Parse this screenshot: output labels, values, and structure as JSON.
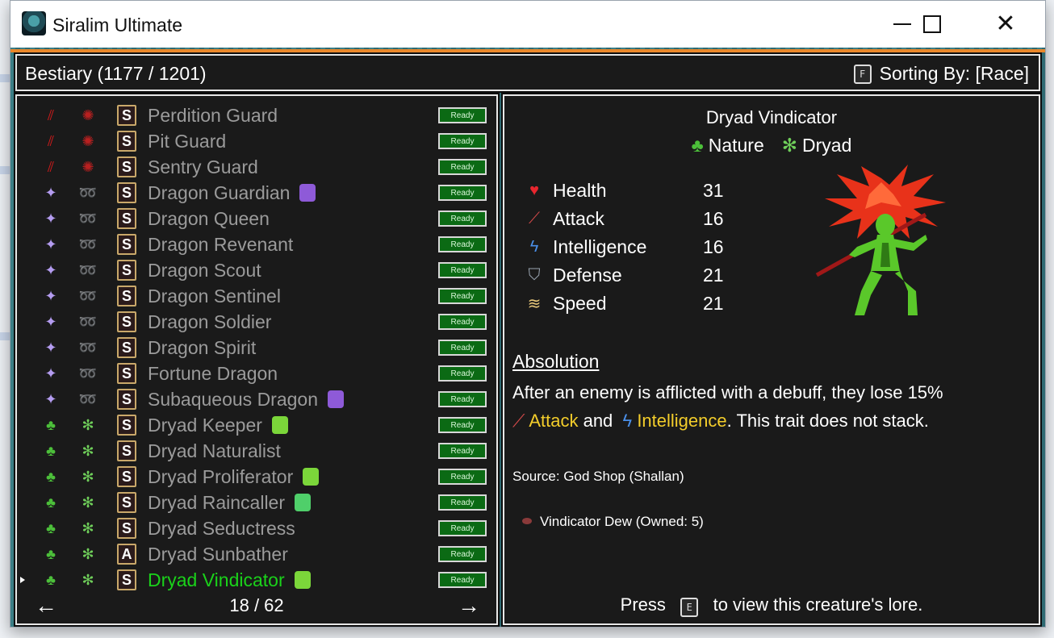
{
  "window": {
    "title": "Siralim Ultimate"
  },
  "header": {
    "bestiary": "Bestiary (1177 / 1201)",
    "sort_key": "F",
    "sorting": "Sorting By: [Race]"
  },
  "list": {
    "rows": [
      {
        "name": "Perdition Guard",
        "class_icon": "claw-icon",
        "race_icon": "demon-icon",
        "rank": "S",
        "status": "Ready"
      },
      {
        "name": "Pit Guard",
        "class_icon": "claw-icon",
        "race_icon": "demon-icon",
        "rank": "S",
        "status": "Ready"
      },
      {
        "name": "Sentry Guard",
        "class_icon": "claw-icon",
        "race_icon": "demon-icon",
        "rank": "S",
        "status": "Ready"
      },
      {
        "name": "Dragon Guardian",
        "class_icon": "sparkle-icon",
        "race_icon": "dragon-icon",
        "rank": "S",
        "status": "Ready",
        "badge": "purple-gem-icon"
      },
      {
        "name": "Dragon Queen",
        "class_icon": "sparkle-icon",
        "race_icon": "dragon-icon",
        "rank": "S",
        "status": "Ready"
      },
      {
        "name": "Dragon Revenant",
        "class_icon": "sparkle-icon",
        "race_icon": "dragon-icon",
        "rank": "S",
        "status": "Ready"
      },
      {
        "name": "Dragon Scout",
        "class_icon": "sparkle-icon",
        "race_icon": "dragon-icon",
        "rank": "S",
        "status": "Ready"
      },
      {
        "name": "Dragon Sentinel",
        "class_icon": "sparkle-icon",
        "race_icon": "dragon-icon",
        "rank": "S",
        "status": "Ready"
      },
      {
        "name": "Dragon Soldier",
        "class_icon": "sparkle-icon",
        "race_icon": "dragon-icon",
        "rank": "S",
        "status": "Ready"
      },
      {
        "name": "Dragon Spirit",
        "class_icon": "sparkle-icon",
        "race_icon": "dragon-icon",
        "rank": "S",
        "status": "Ready"
      },
      {
        "name": "Fortune Dragon",
        "class_icon": "sparkle-icon",
        "race_icon": "dragon-icon",
        "rank": "S",
        "status": "Ready"
      },
      {
        "name": "Subaqueous Dragon",
        "class_icon": "sparkle-icon",
        "race_icon": "dragon-icon",
        "rank": "S",
        "status": "Ready",
        "badge": "purple-gem-icon"
      },
      {
        "name": "Dryad Keeper",
        "class_icon": "leaf-icon",
        "race_icon": "dryad-icon",
        "rank": "S",
        "status": "Ready",
        "badge": "green-slime-icon"
      },
      {
        "name": "Dryad Naturalist",
        "class_icon": "leaf-icon",
        "race_icon": "dryad-icon",
        "rank": "S",
        "status": "Ready"
      },
      {
        "name": "Dryad Proliferator",
        "class_icon": "leaf-icon",
        "race_icon": "dryad-icon",
        "rank": "S",
        "status": "Ready",
        "badge": "green-slime-icon"
      },
      {
        "name": "Dryad Raincaller",
        "class_icon": "leaf-icon",
        "race_icon": "dryad-icon",
        "rank": "S",
        "status": "Ready",
        "badge": "green-gem-icon"
      },
      {
        "name": "Dryad Seductress",
        "class_icon": "leaf-icon",
        "race_icon": "dryad-icon",
        "rank": "S",
        "status": "Ready"
      },
      {
        "name": "Dryad Sunbather",
        "class_icon": "leaf-icon",
        "race_icon": "dryad-icon",
        "rank": "A",
        "status": "Ready"
      },
      {
        "name": "Dryad Vindicator",
        "class_icon": "leaf-icon",
        "race_icon": "dryad-icon",
        "rank": "S",
        "status": "Ready",
        "badge": "green-slime-icon",
        "selected": true
      }
    ],
    "page": "18 / 62"
  },
  "detail": {
    "name": "Dryad Vindicator",
    "class": "Nature",
    "race": "Dryad",
    "stats": [
      {
        "label": "Health",
        "value": "31",
        "icon": "heart-icon"
      },
      {
        "label": "Attack",
        "value": "16",
        "icon": "sword-icon"
      },
      {
        "label": "Intelligence",
        "value": "16",
        "icon": "lightning-icon"
      },
      {
        "label": "Defense",
        "value": "21",
        "icon": "shield-icon"
      },
      {
        "label": "Speed",
        "value": "21",
        "icon": "wing-icon"
      }
    ],
    "trait": {
      "title": "Absolution",
      "desc_1": "After an enemy is afflicted with a debuff, they lose 15%",
      "attack": "Attack",
      "and": "and",
      "intelligence": "Intelligence",
      "desc_2": ". This trait does not stack."
    },
    "source": "Source: God Shop (Shallan)",
    "item": "Vindicator Dew (Owned: 5)",
    "footer_press": "Press",
    "footer_key": "E",
    "footer_rest": "to view this creature's lore."
  },
  "colors": {
    "selected": "#1ad21a",
    "highlight": "#f3cd2b",
    "ready_bg": "#0b6a14"
  }
}
